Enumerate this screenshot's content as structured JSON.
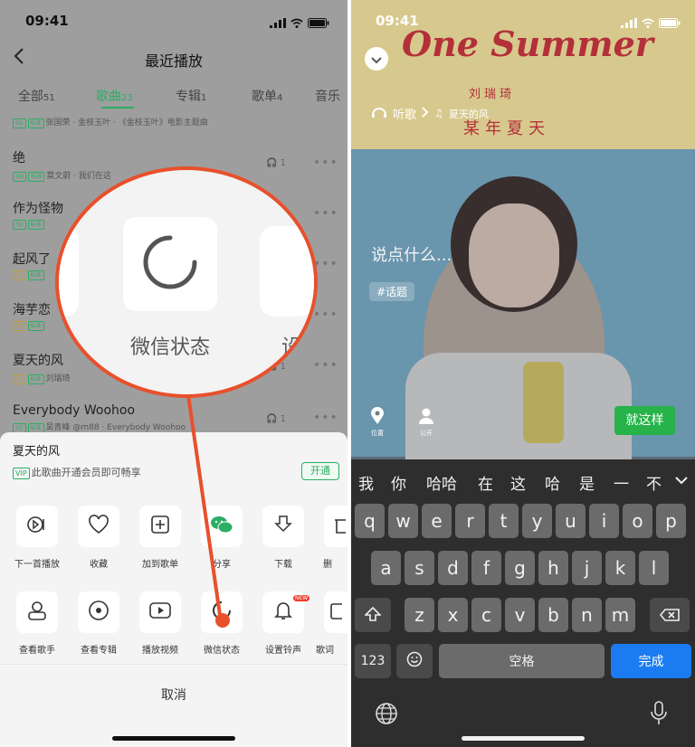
{
  "left": {
    "status": {
      "time": "09:41"
    },
    "header": {
      "title": "最近播放"
    },
    "tabs": [
      {
        "label": "全部",
        "count": "51"
      },
      {
        "label": "歌曲",
        "count": "23"
      },
      {
        "label": "专辑",
        "count": "1"
      },
      {
        "label": "歌单",
        "count": "4"
      },
      {
        "label": "音乐"
      }
    ],
    "songs": [
      {
        "title": "",
        "sub": "张国荣 · 金枝玉叶 · 《金枝玉叶》电影主题曲",
        "count": ""
      },
      {
        "title": "绝",
        "sub": "莫文蔚 · 我们在这",
        "count": "1"
      },
      {
        "title": "作为怪物",
        "sub": "",
        "count": "1"
      },
      {
        "title": "起风了",
        "sub": "",
        "count": "1"
      },
      {
        "title": "海芋恋",
        "sub": "",
        "count": "1"
      },
      {
        "title": "夏天的风",
        "sub": "刘瑞琦",
        "count": "1"
      },
      {
        "title": "Everybody Woohoo",
        "sub": "吴青峰 @m88 · Everybody Woohoo",
        "count": "1"
      }
    ],
    "sheet": {
      "song": "夏天的风",
      "vip_badge": "VIP",
      "vip_text": "此歌曲开通会员即可畅享",
      "open_button": "开通",
      "row1": [
        "下一首播放",
        "收藏",
        "加到歌单",
        "分享",
        "下载",
        "删"
      ],
      "row2": [
        "查看歌手",
        "查看专辑",
        "播放视频",
        "微信状态",
        "设置铃声",
        "歌词"
      ],
      "new_badge": "NEW",
      "cancel": "取消"
    },
    "magnifier": {
      "label": "微信状态",
      "partial_right": "设"
    },
    "accent": "#2cae65",
    "callout_color": "#e8502c"
  },
  "right": {
    "status": {
      "time": "09:41"
    },
    "poster": {
      "title": "One Summer",
      "artist": "刘瑞琦",
      "subtitle": "某年夏天"
    },
    "listen": {
      "label": "听歌",
      "song": "夏天的风"
    },
    "compose": {
      "placeholder": "说点什么...",
      "topic": "#话题"
    },
    "location_label": "位置",
    "public_label": "公开",
    "confirm": "就这样",
    "suggestions": [
      "我",
      "你",
      "哈哈",
      "在",
      "这",
      "哈",
      "是",
      "一",
      "不"
    ],
    "keyboard": {
      "row1": [
        "q",
        "w",
        "e",
        "r",
        "t",
        "y",
        "u",
        "i",
        "o",
        "p"
      ],
      "row2": [
        "a",
        "s",
        "d",
        "f",
        "g",
        "h",
        "j",
        "k",
        "l"
      ],
      "row3": [
        "z",
        "x",
        "c",
        "v",
        "b",
        "n",
        "m"
      ],
      "num": "123",
      "space": "空格",
      "done": "完成"
    },
    "done_color": "#1a7cf0",
    "confirm_color": "#27b24a"
  }
}
